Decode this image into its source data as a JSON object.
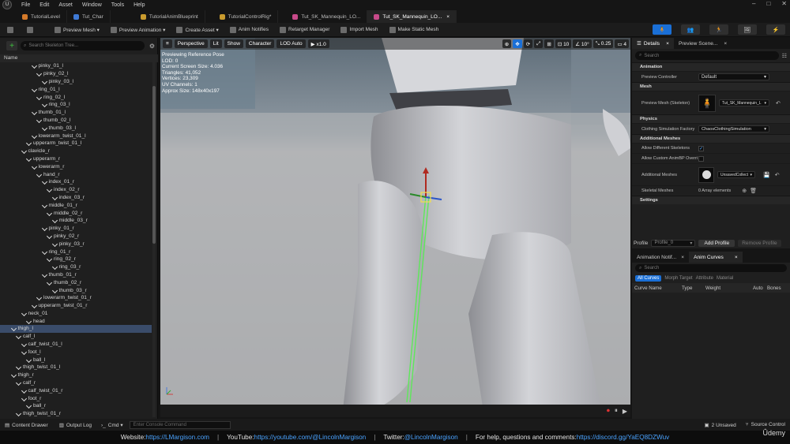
{
  "menu": {
    "logo": "U",
    "items": [
      "File",
      "Edit",
      "Asset",
      "Window",
      "Tools",
      "Help"
    ]
  },
  "window_controls": [
    "–",
    "□",
    "✕"
  ],
  "tabs": [
    {
      "label": "TutorialLevel",
      "color": "#d57a2a"
    },
    {
      "label": "Tut_Char",
      "color": "#3f7ad6"
    },
    {
      "label": "TutorialAnimBlueprint",
      "color": "#c99b2e"
    },
    {
      "label": "TutorialControlRig*",
      "color": "#c99b2e"
    },
    {
      "label": "Tut_SK_Mannequin_LO...",
      "color": "#c84a8a"
    },
    {
      "label": "Tut_SK_Mannequin_LO...",
      "color": "#c84a8a",
      "active": true,
      "close": "×"
    }
  ],
  "toolbar": {
    "items": [
      "Preview Mesh ▾",
      "Preview Animation ▾",
      "Create Asset ▾",
      "Anim Notifies",
      "Retarget Manager",
      "Import Mesh",
      "Make Static Mesh"
    ],
    "modes": [
      "🧍",
      "👥",
      "🏃",
      "🖼",
      "⚡"
    ]
  },
  "skeleton_tree": {
    "add_label": "+",
    "search_placeholder": "Search Skeleton Tree...",
    "column": "Name",
    "rows": [
      {
        "label": "pinky_01_l",
        "indent": 5
      },
      {
        "label": "pinky_02_l",
        "indent": 6
      },
      {
        "label": "pinky_03_l",
        "indent": 7
      },
      {
        "label": "ring_01_l",
        "indent": 5
      },
      {
        "label": "ring_02_l",
        "indent": 6
      },
      {
        "label": "ring_03_l",
        "indent": 7
      },
      {
        "label": "thumb_01_l",
        "indent": 5
      },
      {
        "label": "thumb_02_l",
        "indent": 6
      },
      {
        "label": "thumb_03_l",
        "indent": 7
      },
      {
        "label": "lowerarm_twist_01_l",
        "indent": 5
      },
      {
        "label": "upperarm_twist_01_l",
        "indent": 4
      },
      {
        "label": "clavicle_r",
        "indent": 3
      },
      {
        "label": "upperarm_r",
        "indent": 4
      },
      {
        "label": "lowerarm_r",
        "indent": 5
      },
      {
        "label": "hand_r",
        "indent": 6
      },
      {
        "label": "index_01_r",
        "indent": 7
      },
      {
        "label": "index_02_r",
        "indent": 8
      },
      {
        "label": "index_03_r",
        "indent": 9
      },
      {
        "label": "middle_01_r",
        "indent": 7
      },
      {
        "label": "middle_02_r",
        "indent": 8
      },
      {
        "label": "middle_03_r",
        "indent": 9
      },
      {
        "label": "pinky_01_r",
        "indent": 7
      },
      {
        "label": "pinky_02_r",
        "indent": 8
      },
      {
        "label": "pinky_03_r",
        "indent": 9
      },
      {
        "label": "ring_01_r",
        "indent": 7
      },
      {
        "label": "ring_02_r",
        "indent": 8
      },
      {
        "label": "ring_03_r",
        "indent": 9
      },
      {
        "label": "thumb_01_r",
        "indent": 7
      },
      {
        "label": "thumb_02_r",
        "indent": 8
      },
      {
        "label": "thumb_03_r",
        "indent": 9
      },
      {
        "label": "lowerarm_twist_01_r",
        "indent": 6
      },
      {
        "label": "upperarm_twist_01_r",
        "indent": 5
      },
      {
        "label": "neck_01",
        "indent": 3
      },
      {
        "label": "head",
        "indent": 4
      },
      {
        "label": "thigh_l",
        "indent": 1,
        "selected": true
      },
      {
        "label": "calf_l",
        "indent": 2
      },
      {
        "label": "calf_twist_01_l",
        "indent": 3
      },
      {
        "label": "foot_l",
        "indent": 3
      },
      {
        "label": "ball_l",
        "indent": 4
      },
      {
        "label": "thigh_twist_01_l",
        "indent": 2
      },
      {
        "label": "thigh_r",
        "indent": 1
      },
      {
        "label": "calf_r",
        "indent": 2
      },
      {
        "label": "calf_twist_01_r",
        "indent": 3
      },
      {
        "label": "foot_r",
        "indent": 3
      },
      {
        "label": "ball_r",
        "indent": 4
      },
      {
        "label": "thigh_twist_01_r",
        "indent": 2
      }
    ]
  },
  "viewport": {
    "buttons": [
      "≡",
      "Perspective",
      "Lit",
      "Show",
      "Character",
      "LOD Auto",
      "▶ x1.0"
    ],
    "right_controls": [
      "⊕",
      "✥",
      "⟳",
      "⤢",
      "⊞",
      "⊡ 10",
      "∠ 10°",
      "⤡ 0.25",
      "▭ 4"
    ],
    "stats": [
      "Previewing Reference Pose",
      "LOD: 0",
      "Current Screen Size: 4.036",
      "Triangles: 41,052",
      "Vertices: 23,309",
      "UV Channels: 1",
      "Approx Size: 148x40x197"
    ],
    "playback": [
      "⏺",
      "⏸",
      "▶"
    ]
  },
  "details": {
    "tabs": [
      "Details",
      "×",
      "Preview Scene...",
      "×"
    ],
    "search_placeholder": "Search",
    "sections": {
      "animation": "Animation",
      "mesh": "Mesh",
      "physics": "Physics",
      "additional": "Additional Meshes",
      "settings": "Settings"
    },
    "preview_controller": {
      "label": "Preview Controller",
      "value": "Default"
    },
    "preview_mesh": {
      "label": "Preview Mesh (Skeleton)",
      "value": "Tut_SK_Mannequin_L"
    },
    "clothing": {
      "label": "Clothing Simulation Factory",
      "value": "ChaosClothingSimulation"
    },
    "allow_diff": {
      "label": "Allow Different Skeletons",
      "checked": "✓"
    },
    "allow_custom": {
      "label": "Allow Custom AnimBP Overri"
    },
    "add_meshes": {
      "label": "Additional Meshes",
      "value": "UnsavedCollect"
    },
    "skel_meshes": {
      "label": "Skeletal Meshes",
      "value": "0 Array elements"
    },
    "profile": {
      "label": "Profile",
      "value": "Profile_0",
      "add": "Add Profile",
      "remove": "Remove Profile"
    }
  },
  "curves": {
    "tabs": [
      "Animation Notif...",
      "×",
      "Anim Curves",
      "×"
    ],
    "search_placeholder": "Search",
    "filters": [
      "All Curves",
      "Morph Target",
      "Attribute",
      "Material"
    ],
    "columns": [
      "Curve Name",
      "Type",
      "Weight",
      "Auto",
      "Bones"
    ]
  },
  "statusbar": {
    "content_drawer": "Content Drawer",
    "output_log": "Output Log",
    "cmd": "Cmd ▾",
    "console_placeholder": "Enter Console Command",
    "unsaved": "2 Unsaved",
    "source_control": "Source Control"
  },
  "footer": {
    "website_label": "Website: ",
    "website": "https://LMargison.com",
    "youtube_label": "YouTube: ",
    "youtube": "https://youtube.com/@LincolnMargison",
    "twitter_label": "Twitter: ",
    "twitter": "@LincolnMargison",
    "help_label": "For help, questions and comments: ",
    "discord": "https://discord.gg/YaEQ8DZWuv",
    "separator": "|",
    "brand": "Ûdemy"
  }
}
